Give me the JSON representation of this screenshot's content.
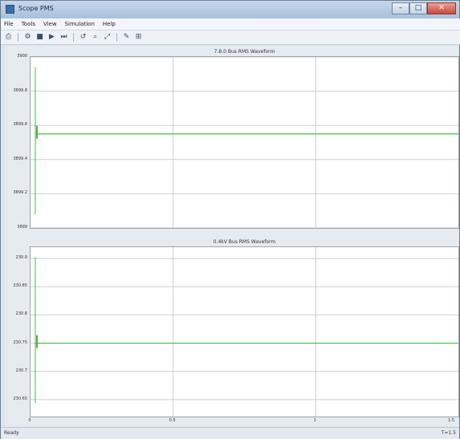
{
  "window": {
    "title": "Scope PMS",
    "caption_buttons": {
      "minimize": "–",
      "maximize": "□",
      "close": "✕"
    }
  },
  "menu": [
    "File",
    "Tools",
    "View",
    "Simulation",
    "Help"
  ],
  "toolbar": [
    {
      "icon": "print-icon",
      "glyph": "⎙"
    },
    {
      "icon": "parameters-icon",
      "glyph": "⚙"
    },
    {
      "icon": "stop-icon",
      "glyph": "■"
    },
    {
      "icon": "run-icon",
      "glyph": "▶"
    },
    {
      "icon": "step-icon",
      "glyph": "⏭"
    },
    {
      "icon": "restore-icon",
      "glyph": "↺"
    },
    {
      "icon": "zoom-icon",
      "glyph": "⌕"
    },
    {
      "icon": "autoscale-icon",
      "glyph": "⤢"
    },
    {
      "icon": "cursor-icon",
      "glyph": "✎"
    },
    {
      "icon": "measure-icon",
      "glyph": "⊞"
    }
  ],
  "colors": {
    "trace": "#3fbf3f",
    "spike": "#2e7d2e",
    "grid": "#c9ced4",
    "axes_bg": "#ffffff"
  },
  "panels": [
    {
      "title": "7.8.0 Bus RMS Waveform",
      "yticks": [
        "3900",
        "3899.8",
        "3899.6",
        "3899.4",
        "3899.2",
        "3899"
      ],
      "ylim": [
        3899,
        3900
      ],
      "trace_value": 3899.55,
      "xticks": []
    },
    {
      "title": "0.4kV Bus RMS Waveform",
      "yticks": [
        "230.9",
        "230.85",
        "230.8",
        "230.75",
        "230.7",
        "230.65"
      ],
      "ylim": [
        230.62,
        230.92
      ],
      "trace_value": 230.75,
      "xticks": [
        "0",
        "0.5",
        "1",
        "1.5"
      ]
    }
  ],
  "status": {
    "left": "Ready",
    "right": "T=1.5"
  }
}
